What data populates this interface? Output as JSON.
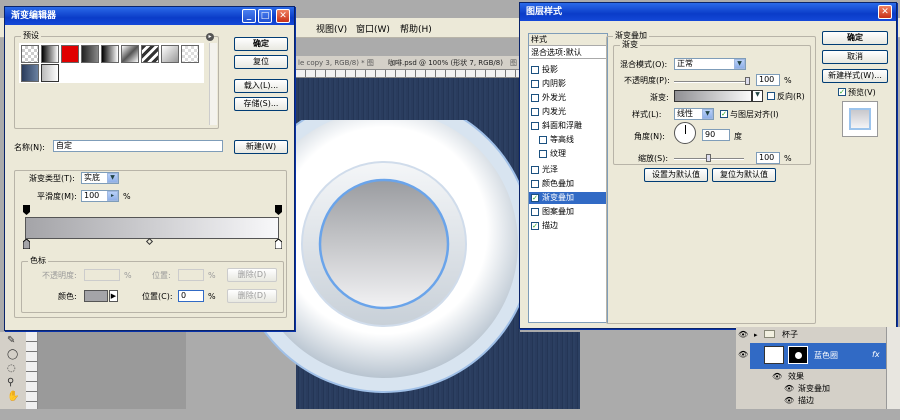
{
  "background_app": {
    "menubar": {
      "view": "视图(V)",
      "window": "窗口(W)",
      "help": "帮助(H)"
    },
    "doc_tabs": [
      "le copy 3, RGB/8) * 图",
      "咖啡.psd @ 100% (形状 7, RGB/8)",
      "图"
    ]
  },
  "gradient_editor": {
    "title": "渐变编辑器",
    "presets_label": "预设",
    "ok": "确定",
    "reset": "复位",
    "load": "载入(L)...",
    "save": "存储(S)...",
    "name_label": "名称(N):",
    "name_value": "自定",
    "new": "新建(W)",
    "type_label": "渐变类型(T):",
    "type_value": "实底",
    "smooth_label": "平滑度(M):",
    "smooth_value": "100",
    "percent": "%",
    "stops_group": "色标",
    "opacity_label": "不透明度:",
    "location_label": "位置:",
    "delete_label": "删除(D)",
    "color_label": "颜色:",
    "location2_label": "位置(C):",
    "location2_value": "0",
    "delete2_label": "删除(D)"
  },
  "layer_style": {
    "title": "图层样式",
    "styles_header": "样式",
    "styles": [
      "混合选项:默认",
      "投影",
      "内阴影",
      "外发光",
      "内发光",
      "斜面和浮雕",
      "等高线",
      "纹理",
      "光泽",
      "颜色叠加",
      "渐变叠加",
      "图案叠加",
      "描边"
    ],
    "gradient_overlay_title": "渐变叠加",
    "gradient_group": "渐变",
    "blend_mode_label": "混合模式(O):",
    "blend_mode_value": "正常",
    "opacity_label": "不透明度(P):",
    "opacity_value": "100",
    "percent": "%",
    "gradient_label": "渐变:",
    "reverse_label": "反向(R)",
    "style_label": "样式(L):",
    "style_value": "线性",
    "align_label": "与图层对齐(I)",
    "angle_label": "角度(N):",
    "angle_value": "90",
    "degree": "度",
    "scale_label": "缩放(S):",
    "scale_value": "100",
    "set_default": "设置为默认值",
    "reset_default": "复位为默认值",
    "ok": "确定",
    "cancel": "取消",
    "new_style": "新建样式(W)...",
    "preview_label": "预览(V)"
  },
  "layers_panel": {
    "group_name": "杯子",
    "layer_name": "蓝色圈",
    "effects_label": "效果",
    "effect1": "渐变叠加",
    "effect2": "描边"
  },
  "colors": {
    "canvas_bg": "#283a5a",
    "accent": "#316ac5",
    "titlebar": "#0a3cc8"
  }
}
